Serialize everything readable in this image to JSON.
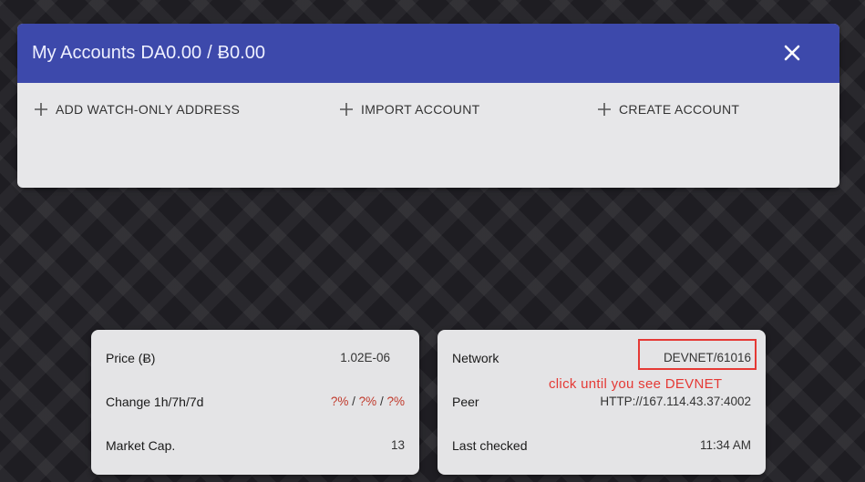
{
  "accounts": {
    "title": "My Accounts",
    "balance_daa": "DA0.00",
    "separator": "/",
    "balance_btc": "Ƀ0.00",
    "actions": [
      {
        "label": "ADD WATCH-ONLY ADDRESS",
        "icon": "plus-icon"
      },
      {
        "label": "IMPORT ACCOUNT",
        "icon": "plus-icon"
      },
      {
        "label": "CREATE ACCOUNT",
        "icon": "plus-icon"
      }
    ],
    "close_icon": "close-icon"
  },
  "price_card": {
    "price_label": "Price (Ƀ)",
    "price_value": "1.02E-06",
    "change_label": "Change 1h/7h/7d",
    "change_1h": "?%",
    "change_7h": "?%",
    "change_7d": "?%",
    "change_sep": "/",
    "market_cap_label": "Market Cap.",
    "market_cap_value": "13"
  },
  "network_card": {
    "network_label": "Network",
    "network_value": "DEVNET/61016",
    "peer_label": "Peer",
    "peer_value": "HTTP://167.114.43.37:4002",
    "last_checked_label": "Last checked",
    "last_checked_value": "11:34 AM"
  },
  "annotation": {
    "text": "click until you see DEVNET",
    "color": "#e53935"
  },
  "colors": {
    "header_bg": "#3d49ab",
    "card_bg": "#e7e7e9",
    "negative": "#c0392b"
  }
}
